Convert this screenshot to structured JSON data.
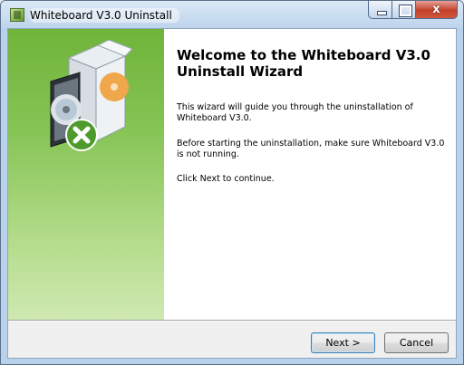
{
  "window": {
    "title": "Whiteboard V3.0 Uninstall",
    "close_glyph": "x"
  },
  "wizard": {
    "heading": "Welcome to the Whiteboard V3.0 Uninstall Wizard",
    "paragraph1": "This wizard will guide you through the uninstallation of Whiteboard V3.0.",
    "paragraph2": "Before starting the uninstallation, make sure Whiteboard V3.0 is not running.",
    "paragraph3": "Click Next to continue."
  },
  "buttons": {
    "next_label": "Next >",
    "cancel_label": "Cancel"
  },
  "icons": {
    "app_icon": "whiteboard-app-icon",
    "sidebar_art": "uninstall-box-icon"
  },
  "colors": {
    "sidebar_green_top": "#6fb43a",
    "sidebar_green_bottom": "#cfe9b1",
    "close_button_red": "#c4412b"
  }
}
